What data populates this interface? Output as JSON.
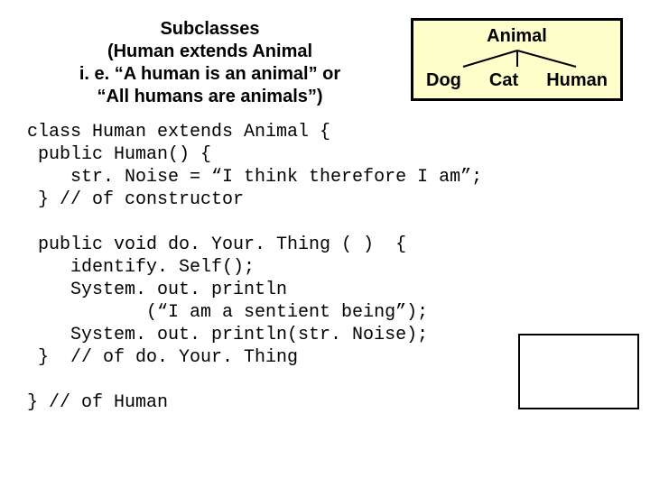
{
  "title": {
    "line1": "Subclasses",
    "line2": "(Human extends Animal",
    "line3": "i. e. “A human is an animal” or",
    "line4": "“All humans are animals”)"
  },
  "diagram": {
    "parent": "Animal",
    "child1": "Dog",
    "child2": "Cat",
    "child3": "Human"
  },
  "code": {
    "l1": "class Human extends Animal {",
    "l2": " public Human() {",
    "l3": "    str. Noise = “I think therefore I am”;",
    "l4": " } // of constructor",
    "l5": "",
    "l6": " public void do. Your. Thing ( )  {",
    "l7": "    identify. Self();",
    "l8": "    System. out. println",
    "l9": "           (“I am a sentient being”);",
    "l10": "    System. out. println(str. Noise);",
    "l11": " }  // of do. Your. Thing",
    "l12": "",
    "l13": "} // of Human"
  }
}
